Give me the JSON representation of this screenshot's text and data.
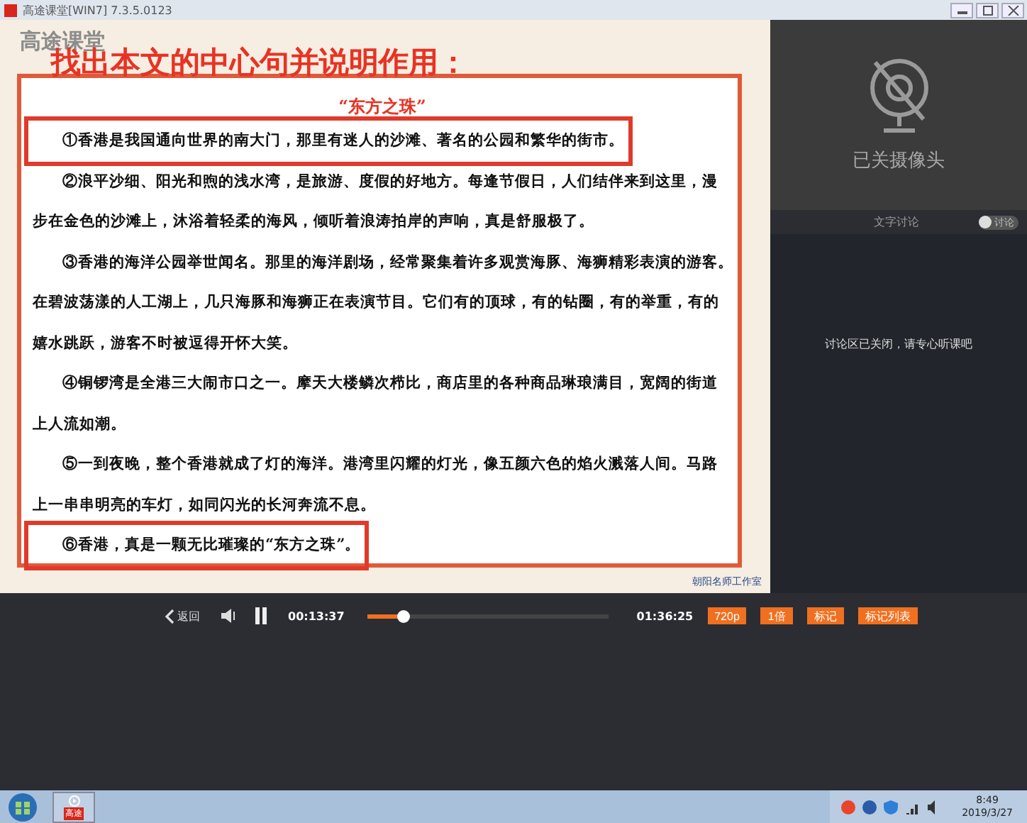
{
  "window": {
    "title": "高途课堂[WIN7] 7.3.5.0123"
  },
  "slide": {
    "logo": "高途课堂",
    "question": "找出本文的中心句并说明作用：",
    "doc_title": "“东方之珠”",
    "paragraphs": [
      {
        "highlighted": true,
        "lines": [
          "①香港是我国通向世界的南大门，那里有迷人的沙滩、著名的公园和繁华的街市。"
        ]
      },
      {
        "highlighted": false,
        "lines": [
          "②浪平沙细、阳光和煦的浅水湾，是旅游、度假的好地方。每逢节假日，人们结伴来到这里，漫",
          "步在金色的沙滩上，沐浴着轻柔的海风，倾听着浪涛拍岸的声响，真是舒服极了。"
        ]
      },
      {
        "highlighted": false,
        "lines": [
          "③香港的海洋公园举世闻名。那里的海洋剧场，经常聚集着许多观赏海豚、海狮精彩表演的游客。",
          "在碧波荡漾的人工湖上，几只海豚和海狮正在表演节目。它们有的顶球，有的钻圈，有的举重，有的",
          "嬉水跳跃，游客不时被逗得开怀大笑。"
        ]
      },
      {
        "highlighted": false,
        "lines": [
          "④铜锣湾是全港三大闹市口之一。摩天大楼鳞次栉比，商店里的各种商品琳琅满目，宽阔的街道",
          "上人流如潮。"
        ]
      },
      {
        "highlighted": false,
        "lines": [
          "⑤一到夜晚，整个香港就成了灯的海洋。港湾里闪耀的灯光，像五颜六色的焰火溅落人间。马路",
          "上一串串明亮的车灯，如同闪光的长河奔流不息。"
        ]
      },
      {
        "highlighted": true,
        "lines": [
          "⑥香港，真是一颗无比璀璨的“东方之珠”。"
        ]
      }
    ],
    "studio": "朝阳名师工作室"
  },
  "camera": {
    "status": "已关摄像头"
  },
  "discussion": {
    "tab": "文字讨论",
    "toggle": {
      "label": "讨论",
      "on": false
    },
    "notice": "讨论区已关闭，请专心听课吧"
  },
  "player": {
    "back": "返回",
    "playing": true,
    "elapsed": "00:13:37",
    "level": 0.15,
    "duration": "01:36:25",
    "buttons": [
      "720p",
      "1倍",
      "标记",
      "标记列表"
    ]
  },
  "taskbar": {
    "app": "高途",
    "time": "8:49",
    "date": "2019/3/27"
  }
}
